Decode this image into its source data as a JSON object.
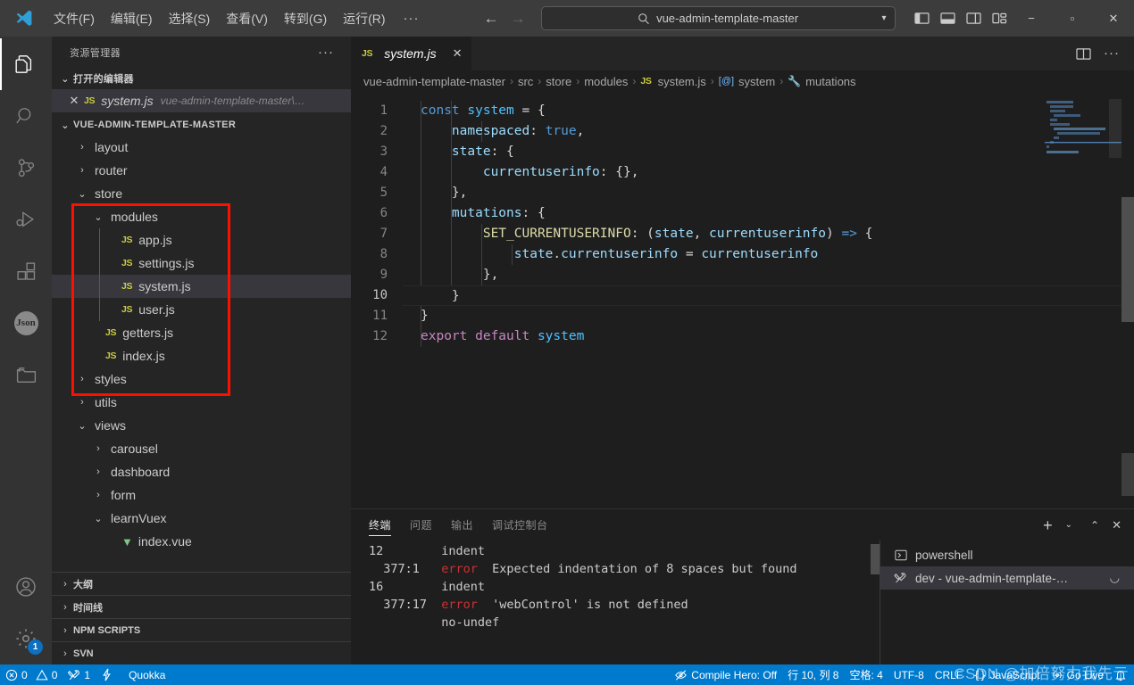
{
  "titlebar": {
    "logo_icon": "vscode-logo-icon",
    "menus": [
      "文件(F)",
      "编辑(E)",
      "选择(S)",
      "查看(V)",
      "转到(G)",
      "运行(R)"
    ],
    "more_label": "···",
    "nav_back_icon": "arrow-left-icon",
    "nav_forward_icon": "arrow-right-icon",
    "search_icon": "search-icon",
    "search_value": "vue-admin-template-master",
    "search_chevron_icon": "chevron-down-icon",
    "layout_icons": [
      "toggle-primary-sidebar-icon",
      "toggle-panel-icon",
      "toggle-secondary-sidebar-icon",
      "customize-layout-icon"
    ],
    "window_minimize": "−",
    "window_maximize": "▫",
    "window_close": "✕"
  },
  "activitybar": {
    "items": [
      {
        "name": "explorer",
        "icon": "files-icon",
        "active": true
      },
      {
        "name": "search",
        "icon": "search-icon",
        "active": false
      },
      {
        "name": "source-control",
        "icon": "source-control-icon",
        "active": false
      },
      {
        "name": "run-and-debug",
        "icon": "run-debug-icon",
        "active": false
      },
      {
        "name": "extensions",
        "icon": "extensions-icon",
        "active": false
      },
      {
        "name": "json",
        "icon": "json-icon",
        "label": "Json",
        "active": false
      },
      {
        "name": "folder",
        "icon": "folder-icon",
        "active": false
      }
    ],
    "bottom": [
      {
        "name": "accounts",
        "icon": "account-icon"
      },
      {
        "name": "manage",
        "icon": "gear-icon",
        "badge": "1"
      }
    ]
  },
  "sidebar": {
    "title": "资源管理器",
    "more_label": "···",
    "open_editors": {
      "label": "打开的编辑器",
      "chevron": "⌄",
      "items": [
        {
          "close": "✕",
          "icon": "js-file-icon",
          "icon_text": "JS",
          "name": "system.js",
          "desc": "vue-admin-template-master\\…",
          "selected": true
        }
      ]
    },
    "project": {
      "label": "VUE-ADMIN-TEMPLATE-MASTER",
      "chevron": "⌄"
    },
    "tree": [
      {
        "name": "layout",
        "type": "folder",
        "expanded": false,
        "depth": 1
      },
      {
        "name": "router",
        "type": "folder",
        "expanded": false,
        "depth": 1
      },
      {
        "name": "store",
        "type": "folder",
        "expanded": true,
        "depth": 1
      },
      {
        "name": "modules",
        "type": "folder",
        "expanded": true,
        "depth": 2
      },
      {
        "name": "app.js",
        "type": "js",
        "depth": 3
      },
      {
        "name": "settings.js",
        "type": "js",
        "depth": 3
      },
      {
        "name": "system.js",
        "type": "js",
        "depth": 3,
        "selected": true
      },
      {
        "name": "user.js",
        "type": "js",
        "depth": 3
      },
      {
        "name": "getters.js",
        "type": "js",
        "depth": 2
      },
      {
        "name": "index.js",
        "type": "js",
        "depth": 2
      },
      {
        "name": "styles",
        "type": "folder",
        "expanded": false,
        "depth": 1
      },
      {
        "name": "utils",
        "type": "folder",
        "expanded": false,
        "depth": 1
      },
      {
        "name": "views",
        "type": "folder",
        "expanded": true,
        "depth": 1
      },
      {
        "name": "carousel",
        "type": "folder",
        "expanded": false,
        "depth": 2
      },
      {
        "name": "dashboard",
        "type": "folder",
        "expanded": false,
        "depth": 2
      },
      {
        "name": "form",
        "type": "folder",
        "expanded": false,
        "depth": 2
      },
      {
        "name": "learnVuex",
        "type": "folder",
        "expanded": true,
        "depth": 2
      },
      {
        "name": "index.vue",
        "type": "vue",
        "depth": 3
      }
    ],
    "bottom_sections": [
      {
        "label": "大纲",
        "chevron": "›"
      },
      {
        "label": "时间线",
        "chevron": "›"
      },
      {
        "label": "NPM SCRIPTS",
        "chevron": "›"
      },
      {
        "label": "SVN",
        "chevron": "›"
      }
    ],
    "annotation_box_color": "#fe1000"
  },
  "editor": {
    "tab": {
      "icon_text": "JS",
      "label": "system.js",
      "close": "✕"
    },
    "tab_actions": [
      "split-editor-icon",
      "more-actions-icon"
    ],
    "breadcrumb": [
      {
        "label": "vue-admin-template-master",
        "icon": ""
      },
      {
        "label": "src",
        "icon": ""
      },
      {
        "label": "store",
        "icon": ""
      },
      {
        "label": "modules",
        "icon": ""
      },
      {
        "label": "system.js",
        "icon": "js-file-icon",
        "icon_text": "JS"
      },
      {
        "label": "system",
        "icon": "symbol-object-icon",
        "icon_text": "[@]"
      },
      {
        "label": "mutations",
        "icon": "symbol-property-icon",
        "icon_text": "🔧"
      }
    ],
    "breadcrumb_separator": "›",
    "line_numbers": [
      "1",
      "2",
      "3",
      "4",
      "5",
      "6",
      "7",
      "8",
      "9",
      "10",
      "11",
      "12"
    ],
    "active_line": 10,
    "code_lines": [
      [
        {
          "t": "const ",
          "c": "kw"
        },
        {
          "t": "system",
          "c": "const"
        },
        {
          "t": " = {",
          "c": "punc"
        }
      ],
      [
        {
          "t": "    ",
          "c": "punc"
        },
        {
          "t": "namespaced",
          "c": "var"
        },
        {
          "t": ": ",
          "c": "punc"
        },
        {
          "t": "true",
          "c": "kw"
        },
        {
          "t": ",",
          "c": "punc"
        }
      ],
      [
        {
          "t": "    ",
          "c": "punc"
        },
        {
          "t": "state",
          "c": "var"
        },
        {
          "t": ": {",
          "c": "punc"
        }
      ],
      [
        {
          "t": "        ",
          "c": "punc"
        },
        {
          "t": "currentuserinfo",
          "c": "var"
        },
        {
          "t": ": {},",
          "c": "punc"
        }
      ],
      [
        {
          "t": "    },",
          "c": "punc"
        }
      ],
      [
        {
          "t": "    ",
          "c": "punc"
        },
        {
          "t": "mutations",
          "c": "var"
        },
        {
          "t": ": {",
          "c": "punc"
        }
      ],
      [
        {
          "t": "        ",
          "c": "punc"
        },
        {
          "t": "SET_CURRENTUSERINFO",
          "c": "fn"
        },
        {
          "t": ": (",
          "c": "punc"
        },
        {
          "t": "state",
          "c": "var"
        },
        {
          "t": ", ",
          "c": "punc"
        },
        {
          "t": "currentuserinfo",
          "c": "var"
        },
        {
          "t": ") ",
          "c": "punc"
        },
        {
          "t": "=>",
          "c": "arrow"
        },
        {
          "t": " {",
          "c": "punc"
        }
      ],
      [
        {
          "t": "            ",
          "c": "punc"
        },
        {
          "t": "state",
          "c": "var"
        },
        {
          "t": ".",
          "c": "punc"
        },
        {
          "t": "currentuserinfo",
          "c": "var"
        },
        {
          "t": " = ",
          "c": "punc"
        },
        {
          "t": "currentuserinfo",
          "c": "var"
        }
      ],
      [
        {
          "t": "        },",
          "c": "punc"
        }
      ],
      [
        {
          "t": "    }",
          "c": "punc"
        }
      ],
      [
        {
          "t": "}",
          "c": "punc"
        }
      ],
      [
        {
          "t": "export default ",
          "c": "kw2"
        },
        {
          "t": "system",
          "c": "const"
        }
      ]
    ]
  },
  "panel": {
    "tabs": [
      {
        "label": "终端",
        "active": true
      },
      {
        "label": "问题",
        "active": false
      },
      {
        "label": "输出",
        "active": false
      },
      {
        "label": "调试控制台",
        "active": false
      }
    ],
    "actions": [
      "new-terminal-icon",
      "terminal-dropdown-icon",
      "maximize-panel-icon",
      "close-panel-icon"
    ],
    "new_terminal_label": "+",
    "dropdown_label": "⌄",
    "maximize_label": "⌃",
    "close_label": "✕",
    "terminal_output": [
      [
        {
          "t": "12        indent",
          "c": ""
        }
      ],
      [
        {
          "t": "  377:1   ",
          "c": ""
        },
        {
          "t": "error",
          "c": "err"
        },
        {
          "t": "  Expected indentation of 8 spaces but found",
          "c": ""
        }
      ],
      [
        {
          "t": "16        indent",
          "c": ""
        }
      ],
      [
        {
          "t": "  377:17  ",
          "c": ""
        },
        {
          "t": "error",
          "c": "err"
        },
        {
          "t": "  'webControl' is not defined",
          "c": ""
        }
      ],
      [
        {
          "t": "          no-undef",
          "c": ""
        }
      ]
    ],
    "terminal_list": [
      {
        "label": "powershell",
        "icon": "terminal-icon",
        "active": false
      },
      {
        "label": "dev - vue-admin-template-…",
        "icon": "tools-icon",
        "active": true,
        "spinner": "◡"
      }
    ]
  },
  "statusbar": {
    "left": [
      {
        "name": "problems",
        "icon": "error-icon",
        "label": "0",
        "icon2": "warning-icon",
        "label2": "0"
      },
      {
        "name": "svn",
        "icon": "tools-icon",
        "label": "1"
      },
      {
        "name": "quokka-bolt",
        "icon": "bolt-icon",
        "label": ""
      },
      {
        "name": "quokka",
        "icon": "",
        "label": "Quokka"
      }
    ],
    "right": [
      {
        "name": "compile-hero",
        "icon": "eye-off-icon",
        "label": "Compile Hero: Off"
      },
      {
        "name": "cursor-position",
        "icon": "",
        "label": "行 10, 列 8"
      },
      {
        "name": "indentation",
        "icon": "",
        "label": "空格: 4"
      },
      {
        "name": "encoding",
        "icon": "",
        "label": "UTF-8"
      },
      {
        "name": "eol",
        "icon": "",
        "label": "CRLF"
      },
      {
        "name": "language-mode",
        "icon": "braces-icon",
        "label": "JavaScript"
      },
      {
        "name": "go-live",
        "icon": "broadcast-icon",
        "label": "Go Live"
      },
      {
        "name": "notifications",
        "icon": "bell-icon",
        "label": ""
      }
    ],
    "watermark": "CSDN @加倍努力我先亍"
  }
}
